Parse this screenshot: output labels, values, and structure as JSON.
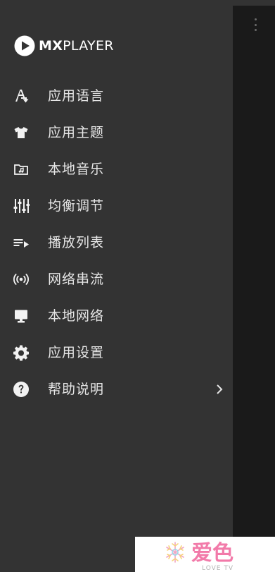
{
  "app": {
    "logo_bold": "MX",
    "logo_light": "PLAYER"
  },
  "menu": [
    {
      "id": "language",
      "icon": "language-icon",
      "label": "应用语言"
    },
    {
      "id": "theme",
      "icon": "tshirt-icon",
      "label": "应用主题"
    },
    {
      "id": "local-music",
      "icon": "music-folder-icon",
      "label": "本地音乐"
    },
    {
      "id": "equalizer",
      "icon": "equalizer-icon",
      "label": "均衡调节"
    },
    {
      "id": "playlist",
      "icon": "playlist-icon",
      "label": "播放列表"
    },
    {
      "id": "network-stream",
      "icon": "broadcast-icon",
      "label": "网络串流"
    },
    {
      "id": "local-network",
      "icon": "monitor-icon",
      "label": "本地网络"
    },
    {
      "id": "settings",
      "icon": "gear-icon",
      "label": "应用设置"
    },
    {
      "id": "help",
      "icon": "help-icon",
      "label": "帮助说明"
    }
  ],
  "watermark": {
    "title": "爱色",
    "subtitle": "LOVE TV"
  },
  "colors": {
    "drawer_bg": "#333333",
    "content_bg": "#1a1a1a",
    "text": "#e6e6e6",
    "icon": "#f2f2f2"
  }
}
